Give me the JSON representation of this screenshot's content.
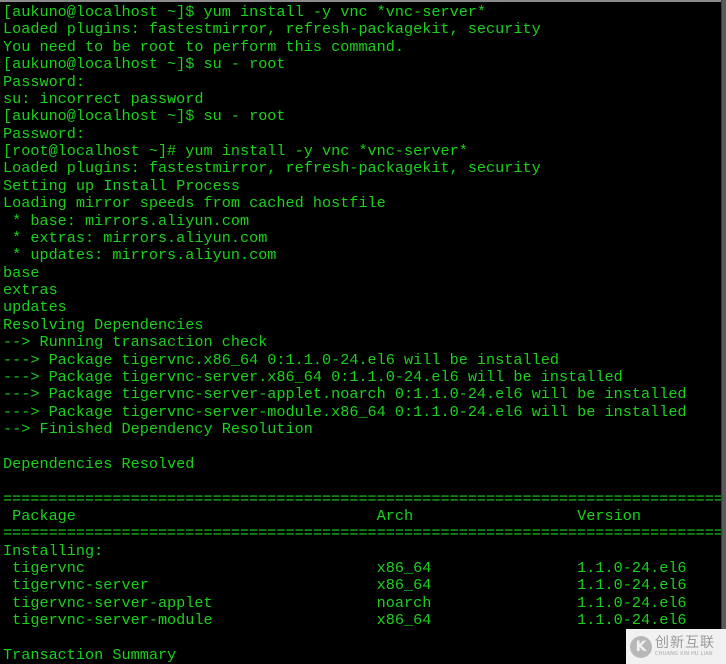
{
  "terminal": {
    "text_color": "#19d219",
    "background": "#000000",
    "lines": [
      "[aukuno@localhost ~]$ yum install -y vnc *vnc-server*",
      "Loaded plugins: fastestmirror, refresh-packagekit, security",
      "You need to be root to perform this command.",
      "[aukuno@localhost ~]$ su - root",
      "Password:",
      "su: incorrect password",
      "[aukuno@localhost ~]$ su - root",
      "Password:",
      "[root@localhost ~]# yum install -y vnc *vnc-server*",
      "Loaded plugins: fastestmirror, refresh-packagekit, security",
      "Setting up Install Process",
      "Loading mirror speeds from cached hostfile",
      " * base: mirrors.aliyun.com",
      " * extras: mirrors.aliyun.com",
      " * updates: mirrors.aliyun.com",
      "base",
      "extras",
      "updates",
      "Resolving Dependencies",
      "--> Running transaction check",
      "---> Package tigervnc.x86_64 0:1.1.0-24.el6 will be installed",
      "---> Package tigervnc-server.x86_64 0:1.1.0-24.el6 will be installed",
      "---> Package tigervnc-server-applet.noarch 0:1.1.0-24.el6 will be installed",
      "---> Package tigervnc-server-module.x86_64 0:1.1.0-24.el6 will be installed",
      "--> Finished Dependency Resolution",
      "",
      "Dependencies Resolved",
      "",
      "================================================================================",
      " Package                                 Arch                  Version",
      "================================================================================",
      "Installing:",
      " tigervnc                                x86_64                1.1.0-24.el6",
      " tigervnc-server                         x86_64                1.1.0-24.el6",
      " tigervnc-server-applet                  noarch                1.1.0-24.el6",
      " tigervnc-server-module                  x86_64                1.1.0-24.el6",
      "",
      "Transaction Summary"
    ]
  },
  "watermark": {
    "logo_glyph": "K",
    "brand_cn": "创新互联",
    "brand_en": "CHUANG XIN HU LIAN"
  }
}
